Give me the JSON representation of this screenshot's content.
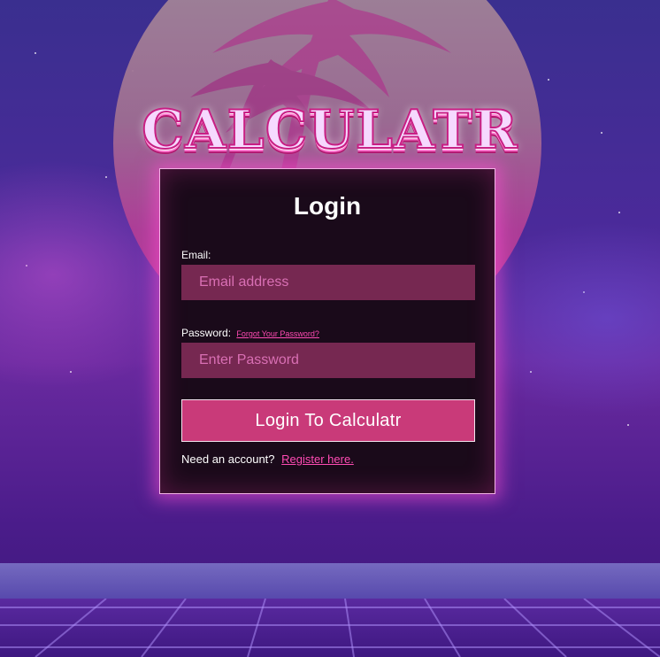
{
  "app": {
    "logo": "CALCULATR"
  },
  "login": {
    "title": "Login",
    "email_label": "Email:",
    "email_placeholder": "Email address",
    "password_label": "Password:",
    "forgot_text": "Forgot Your Password?",
    "password_placeholder": "Enter Password",
    "submit_label": "Login  To  Calculatr",
    "need_account_text": "Need an account?",
    "register_text": "Register here."
  },
  "theme": {
    "accent": "#c93a79",
    "link": "#ff4bb3",
    "card_bg": "#1a0a1a"
  },
  "icons": [
    "palm-tree-icon",
    "sun-icon"
  ]
}
